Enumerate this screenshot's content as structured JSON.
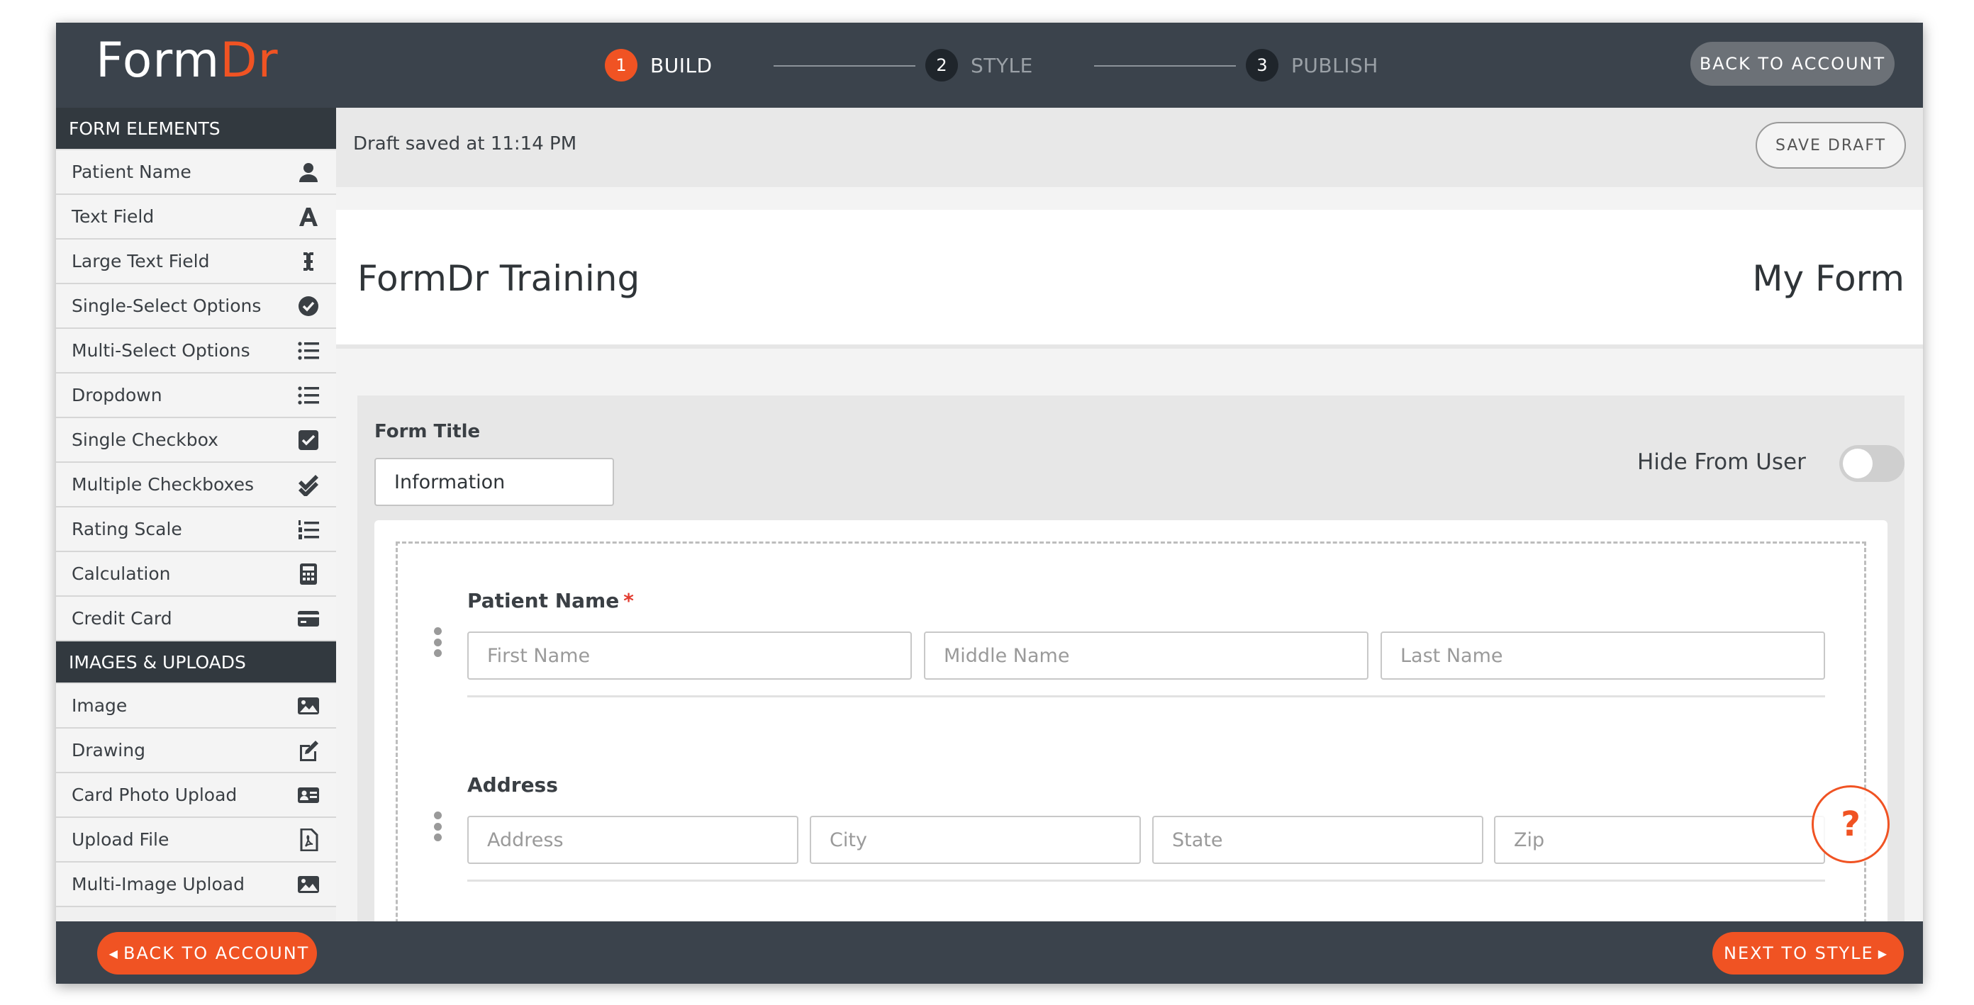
{
  "brand": {
    "logo_primary": "Form",
    "logo_accent": "Dr",
    "accent_color": "#f05323",
    "bar_color": "#3b434c"
  },
  "steps": [
    {
      "num": "1",
      "label": "BUILD",
      "active": true
    },
    {
      "num": "2",
      "label": "STYLE",
      "active": false
    },
    {
      "num": "3",
      "label": "PUBLISH",
      "active": false
    }
  ],
  "top_back_label": "BACK TO ACCOUNT",
  "sidebar": {
    "form_elements_title": "FORM ELEMENTS",
    "form_elements": [
      {
        "label": "Patient Name",
        "icon": "user-icon"
      },
      {
        "label": "Text Field",
        "icon": "text-icon"
      },
      {
        "label": "Large Text Field",
        "icon": "text-cursor-icon"
      },
      {
        "label": "Single-Select Options",
        "icon": "check-circle-icon"
      },
      {
        "label": "Multi-Select Options",
        "icon": "list-icon"
      },
      {
        "label": "Dropdown",
        "icon": "list-icon"
      },
      {
        "label": "Single Checkbox",
        "icon": "checkbox-icon"
      },
      {
        "label": "Multiple Checkboxes",
        "icon": "double-check-icon"
      },
      {
        "label": "Rating Scale",
        "icon": "numbered-list-icon"
      },
      {
        "label": "Calculation",
        "icon": "calculator-icon"
      },
      {
        "label": "Credit Card",
        "icon": "credit-card-icon"
      }
    ],
    "uploads_title": "IMAGES & UPLOADS",
    "uploads": [
      {
        "label": "Image",
        "icon": "image-icon"
      },
      {
        "label": "Drawing",
        "icon": "edit-icon"
      },
      {
        "label": "Card Photo Upload",
        "icon": "id-card-icon"
      },
      {
        "label": "Upload File",
        "icon": "pdf-file-icon"
      },
      {
        "label": "Multi-Image Upload",
        "icon": "images-icon"
      }
    ]
  },
  "subbar": {
    "draft_status": "Draft saved at 11:14 PM",
    "save_draft_label": "SAVE DRAFT"
  },
  "header": {
    "org_name": "FormDr Training",
    "form_name": "My Form"
  },
  "section": {
    "form_title_label": "Form Title",
    "form_title_value": "Information",
    "hide_from_user_label": "Hide From User",
    "hide_from_user_on": false
  },
  "fields": {
    "patient_name": {
      "label": "Patient Name",
      "required_mark": "*",
      "placeholders": [
        "First Name",
        "Middle Name",
        "Last Name"
      ]
    },
    "address": {
      "label": "Address",
      "placeholders": [
        "Address",
        "City",
        "State",
        "Zip"
      ]
    }
  },
  "help_glyph": "?",
  "bottom": {
    "back_label": "BACK TO ACCOUNT",
    "next_label": "NEXT TO STYLE"
  }
}
